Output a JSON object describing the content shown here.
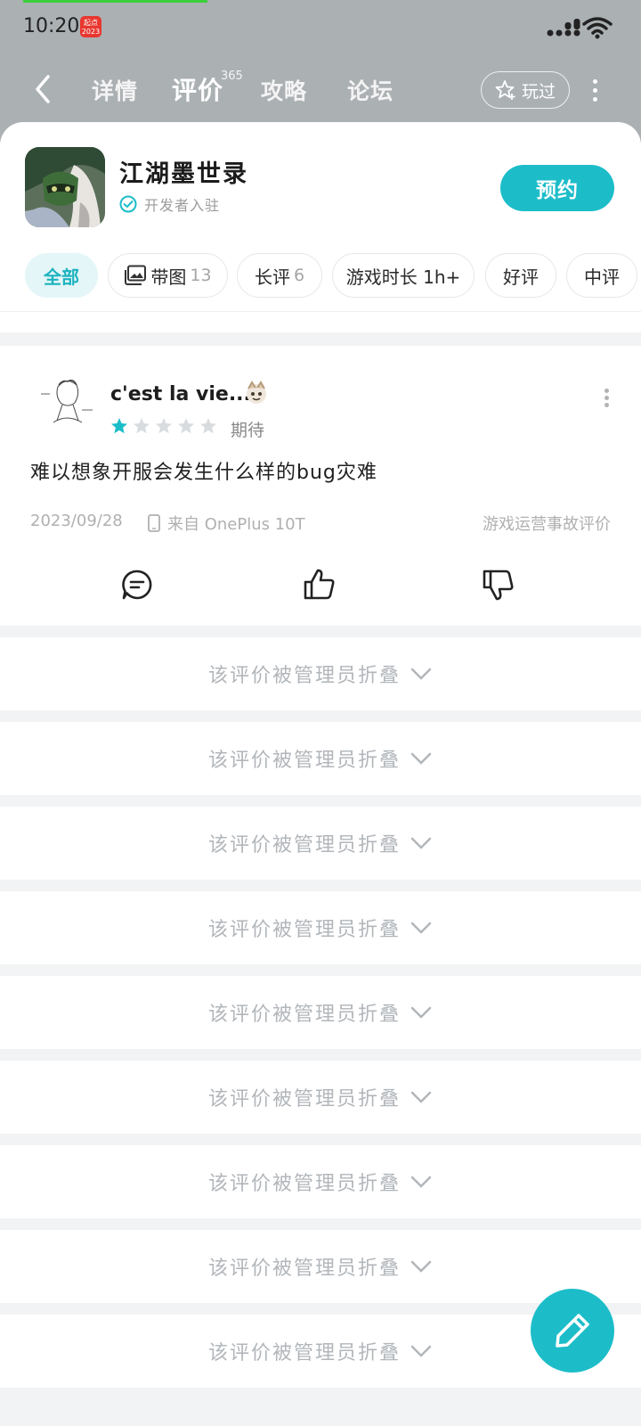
{
  "status_bar": {
    "time": "10:20",
    "badge": "起点 2023"
  },
  "nav": {
    "tabs": [
      {
        "label": "详情"
      },
      {
        "label": "评价",
        "count": "365"
      },
      {
        "label": "攻略"
      },
      {
        "label": "论坛"
      }
    ],
    "played_label": "玩过"
  },
  "game": {
    "title": "江湖墨世录",
    "verified_label": "开发者入驻",
    "reserve_label": "预约"
  },
  "filters": [
    {
      "label": "全部",
      "count": ""
    },
    {
      "label": "带图",
      "count": "13"
    },
    {
      "label": "长评",
      "count": "6"
    },
    {
      "label": "游戏时长 1h+",
      "count": ""
    },
    {
      "label": "好评",
      "count": ""
    },
    {
      "label": "中评",
      "count": ""
    }
  ],
  "review": {
    "username": "c'est la vie...",
    "rating": 1,
    "rating_max": 5,
    "rating_label": "期待",
    "body": "难以想象开服会发生什么样的bug灾难",
    "date": "2023/09/28",
    "device": "来自 OnePlus 10T",
    "tag": "游戏运营事故评价"
  },
  "folded": [
    "该评价被管理员折叠",
    "该评价被管理员折叠",
    "该评价被管理员折叠",
    "该评价被管理员折叠",
    "该评价被管理员折叠",
    "该评价被管理员折叠",
    "该评价被管理员折叠",
    "该评价被管理员折叠",
    "该评价被管理员折叠"
  ],
  "colors": {
    "accent": "#1cbdc9",
    "header_bg": "#abb0b3",
    "folded_text": "#b2b6ba"
  },
  "icons": [
    "back-icon",
    "star-plus-icon",
    "more-vertical-icon",
    "verified-icon",
    "image-icon",
    "phone-icon",
    "comment-icon",
    "thumbs-up-icon",
    "thumbs-down-icon",
    "chevron-down-icon",
    "edit-pencil-icon"
  ]
}
